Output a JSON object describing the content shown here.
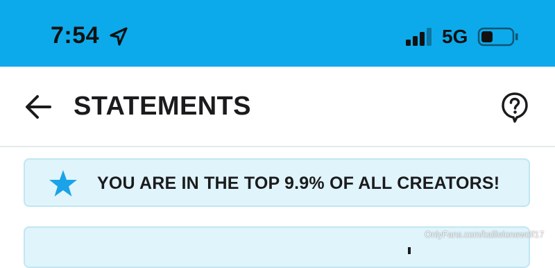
{
  "status_bar": {
    "time": "7:54",
    "network": "5G",
    "icons": {
      "location": "location-arrow-icon",
      "signal": "cellular-signal-icon",
      "battery": "battery-icon"
    },
    "battery_level": 0.3,
    "signal_bars": 4
  },
  "header": {
    "title": "STATEMENTS",
    "icons": {
      "back": "arrow-left-icon",
      "help": "question-bubble-icon"
    }
  },
  "banner": {
    "text": "YOU ARE IN THE TOP 9.9% OF ALL CREATORS!",
    "icon": "star-icon"
  },
  "watermark": "OnlyFans.com/kallielonewolf17",
  "colors": {
    "status_bar_bg": "#0daaeb",
    "banner_bg": "#dff4fb",
    "banner_border": "#c1e6f3",
    "star": "#1aa3e8"
  }
}
